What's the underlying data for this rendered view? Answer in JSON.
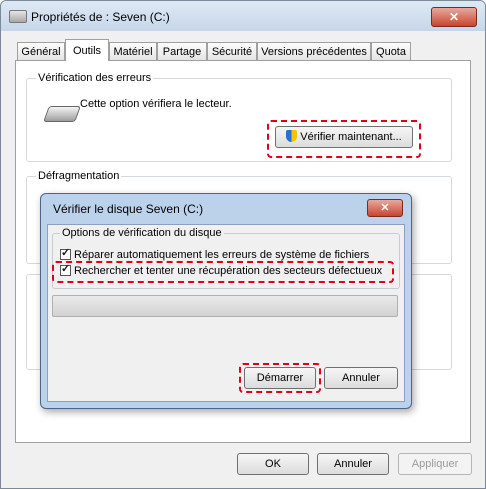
{
  "window": {
    "title": "Propriétés de : Seven (C:)",
    "close_glyph": "✕"
  },
  "tabs": [
    {
      "label": "Général"
    },
    {
      "label": "Outils"
    },
    {
      "label": "Matériel"
    },
    {
      "label": "Partage"
    },
    {
      "label": "Sécurité"
    },
    {
      "label": "Versions précédentes"
    },
    {
      "label": "Quota"
    }
  ],
  "error_check": {
    "title": "Vérification des erreurs",
    "description": "Cette option vérifiera le lecteur.",
    "button": "Vérifier maintenant..."
  },
  "defrag": {
    "title": "Défragmentation"
  },
  "dialog": {
    "title": "Vérifier le disque Seven (C:)",
    "close_glyph": "✕",
    "group_title": "Options de vérification du disque",
    "option1": {
      "label": "Réparer automatiquement les erreurs de système de fichiers",
      "checked": true
    },
    "option2": {
      "label": "Rechercher et tenter une récupération des secteurs défectueux",
      "checked": true
    },
    "progress": 0,
    "start_button": "Démarrer",
    "cancel_button": "Annuler"
  },
  "footer": {
    "ok": "OK",
    "cancel": "Annuler",
    "apply": "Appliquer"
  },
  "colors": {
    "highlight": "#e0001a",
    "dialog_frame": "#bcd1ea"
  }
}
